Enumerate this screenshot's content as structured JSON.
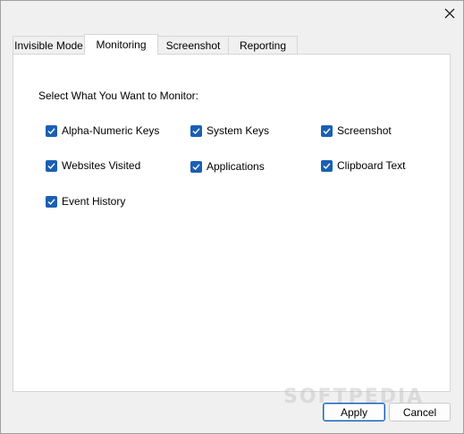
{
  "window": {
    "close_icon": "close-icon"
  },
  "tabs": [
    {
      "label": "Invisible Mode",
      "active": false
    },
    {
      "label": "Monitoring",
      "active": true
    },
    {
      "label": "Screenshot",
      "active": false
    },
    {
      "label": "Reporting",
      "active": false
    }
  ],
  "monitoring": {
    "section_label": "Select What You Want to Monitor:",
    "options": [
      {
        "label": "Alpha-Numeric Keys",
        "checked": true
      },
      {
        "label": "System Keys",
        "checked": true
      },
      {
        "label": "Screenshot",
        "checked": true
      },
      {
        "label": "Websites Visited",
        "checked": true
      },
      {
        "label": "Applications",
        "checked": true
      },
      {
        "label": "Clipboard Text",
        "checked": true
      },
      {
        "label": "Event History",
        "checked": true
      }
    ]
  },
  "buttons": {
    "apply_label": "Apply",
    "cancel_label": "Cancel"
  },
  "watermark": "SOFTPEDIA",
  "colors": {
    "checkbox_accent": "#1a5fb4",
    "window_bg": "#f0f0f0",
    "panel_bg": "#ffffff"
  }
}
